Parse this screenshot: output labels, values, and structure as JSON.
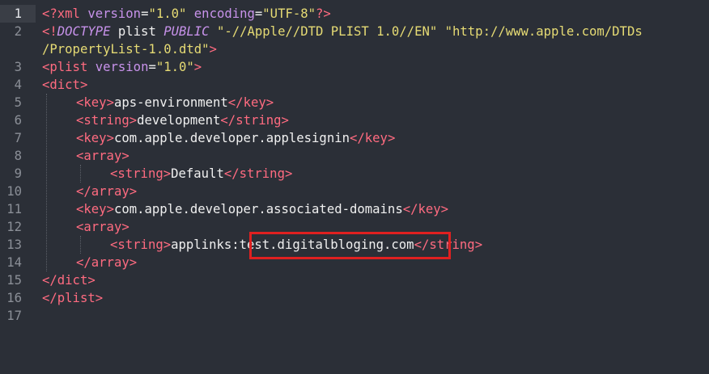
{
  "colors": {
    "background": "#2b2f37",
    "gutter_active": "#3a3e46",
    "tag": "#ff6b80",
    "attribute": "#c792ea",
    "string": "#e6db74",
    "text": "#f0f0f0",
    "highlight_border": "#e02020"
  },
  "editor": {
    "line_numbers": [
      "1",
      "2",
      "3",
      "4",
      "5",
      "6",
      "7",
      "8",
      "9",
      "10",
      "11",
      "12",
      "13",
      "14",
      "15",
      "16",
      "17"
    ],
    "active_line": "1",
    "lines": {
      "l1": {
        "open": "<?",
        "name": "xml",
        "attr1": "version",
        "eq1": "=",
        "val1": "\"1.0\"",
        "attr2": "encoding",
        "eq2": "=",
        "val2": "\"UTF-8\"",
        "close": "?>"
      },
      "l2": {
        "open": "<!",
        "name": "DOCTYPE",
        "sp1": " ",
        "root": "plist",
        "sp2": " ",
        "kw": "PUBLIC",
        "sp3": " ",
        "val1": "\"-//Apple//DTD PLIST 1.0//EN\"",
        "sp4": " ",
        "val2a": "\"http://www.apple.com/DTDs"
      },
      "l2b": {
        "val2b": "/PropertyList-1.0.dtd\"",
        "close": ">"
      },
      "l3": {
        "open": "<",
        "name": "plist",
        "attr": "version",
        "eq": "=",
        "val": "\"1.0\"",
        "close": ">"
      },
      "l4": {
        "open": "<",
        "name": "dict",
        "close": ">"
      },
      "l5": {
        "open": "<",
        "name": "key",
        "close": ">",
        "text": "aps-environment",
        "open2": "</",
        "name2": "key",
        "close2": ">"
      },
      "l6": {
        "open": "<",
        "name": "string",
        "close": ">",
        "text": "development",
        "open2": "</",
        "name2": "string",
        "close2": ">"
      },
      "l7": {
        "open": "<",
        "name": "key",
        "close": ">",
        "text": "com.apple.developer.applesignin",
        "open2": "</",
        "name2": "key",
        "close2": ">"
      },
      "l8": {
        "open": "<",
        "name": "array",
        "close": ">"
      },
      "l9": {
        "open": "<",
        "name": "string",
        "close": ">",
        "text": "Default",
        "open2": "</",
        "name2": "string",
        "close2": ">"
      },
      "l10": {
        "open": "</",
        "name": "array",
        "close": ">"
      },
      "l11": {
        "open": "<",
        "name": "key",
        "close": ">",
        "text": "com.apple.developer.associated-domains",
        "open2": "</",
        "name2": "key",
        "close2": ">"
      },
      "l12": {
        "open": "<",
        "name": "array",
        "close": ">"
      },
      "l13": {
        "open": "<",
        "name": "string",
        "close": ">",
        "text": "applinks:test.digitalbloging.com",
        "open2": "</",
        "name2": "string",
        "close2": ">"
      },
      "l14": {
        "open": "</",
        "name": "array",
        "close": ">"
      },
      "l15": {
        "open": "</",
        "name": "dict",
        "close": ">"
      },
      "l16": {
        "open": "</",
        "name": "plist",
        "close": ">"
      }
    }
  }
}
